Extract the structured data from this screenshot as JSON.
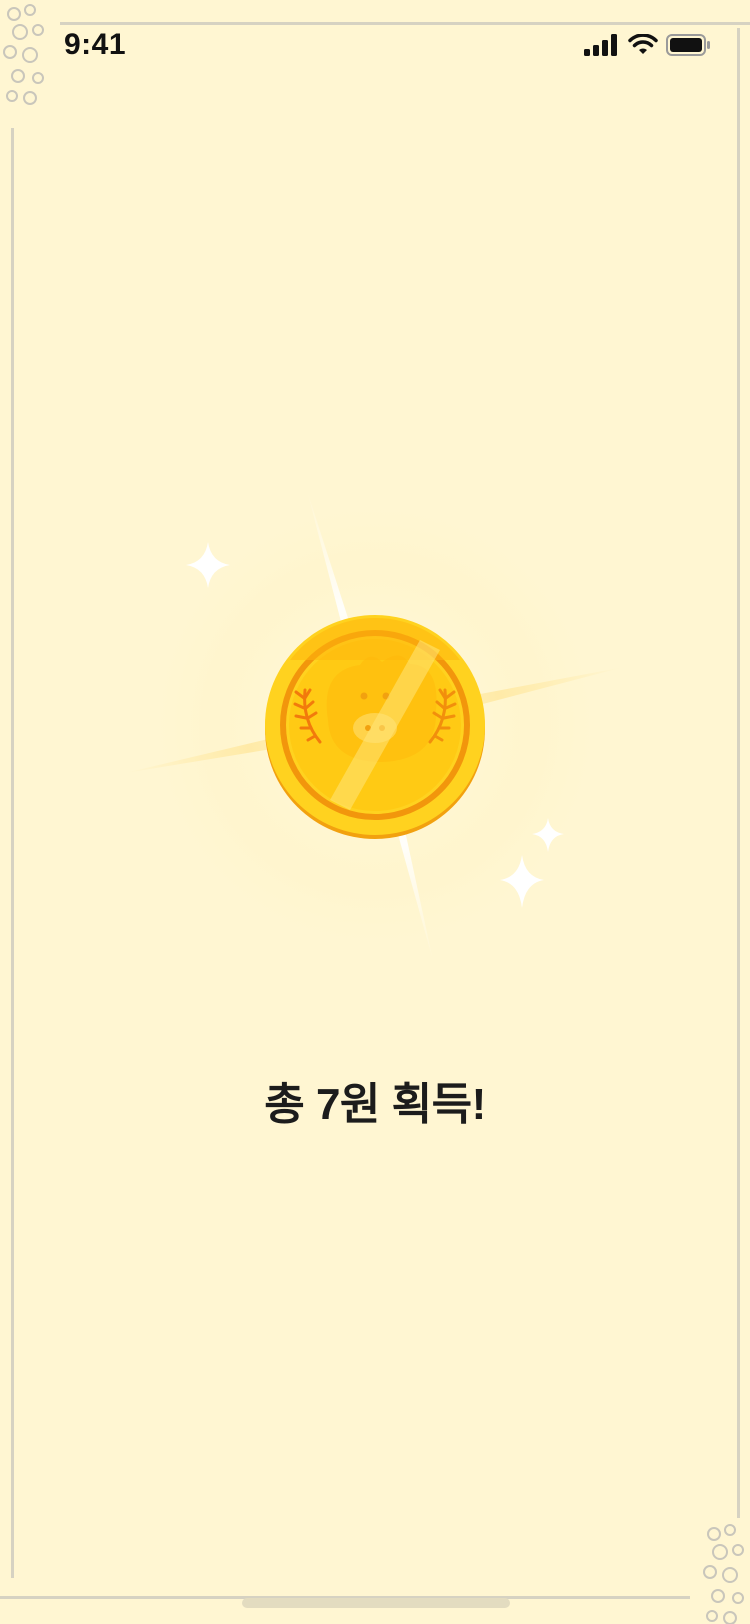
{
  "status_bar": {
    "time": "9:41",
    "icons": [
      "signal-icon",
      "wifi-icon",
      "battery-icon"
    ]
  },
  "reward": {
    "message": "총 7원 획득!"
  },
  "colors": {
    "background": "#fff6d2",
    "coin_gold": "#ffd21f",
    "coin_ring": "#f2a10f",
    "text": "#1c1c1c"
  }
}
